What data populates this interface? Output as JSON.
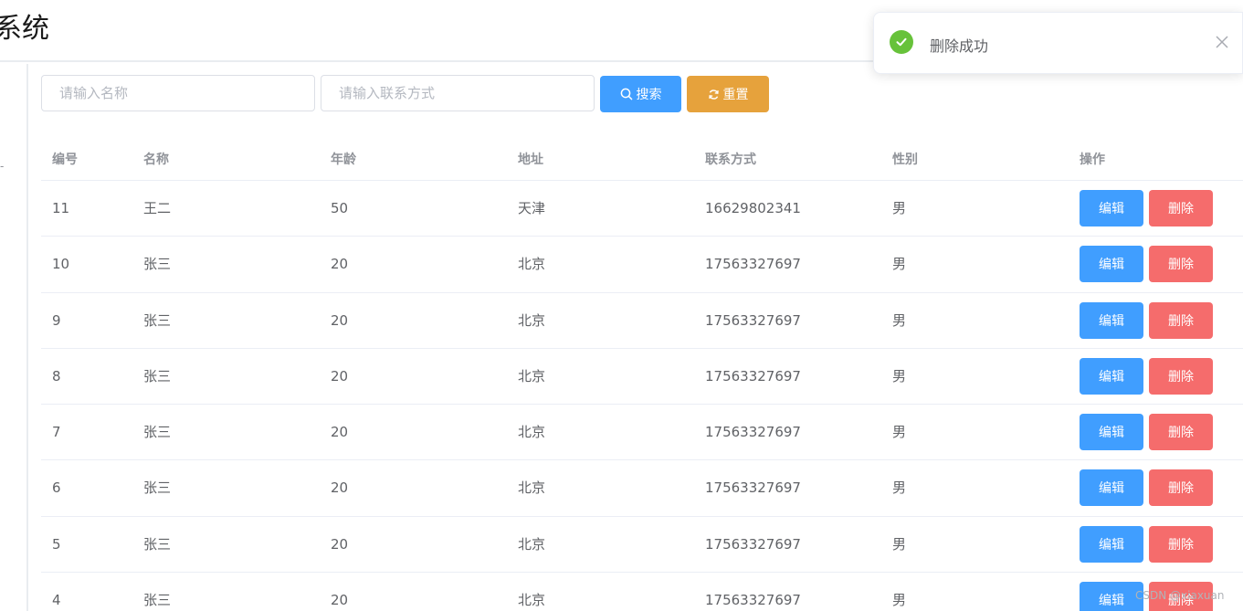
{
  "header": {
    "title": "系统"
  },
  "sidebar": {
    "mark": "-"
  },
  "search": {
    "name_placeholder": "请输入名称",
    "contact_placeholder": "请输入联系方式",
    "search_label": "搜索",
    "reset_label": "重置"
  },
  "table": {
    "columns": [
      "编号",
      "名称",
      "年龄",
      "地址",
      "联系方式",
      "性别",
      "操作"
    ],
    "rows": [
      {
        "id": "11",
        "name": "王二",
        "age": "50",
        "address": "天津",
        "phone": "16629802341",
        "gender": "男"
      },
      {
        "id": "10",
        "name": "张三",
        "age": "20",
        "address": "北京",
        "phone": "17563327697",
        "gender": "男"
      },
      {
        "id": "9",
        "name": "张三",
        "age": "20",
        "address": "北京",
        "phone": "17563327697",
        "gender": "男"
      },
      {
        "id": "8",
        "name": "张三",
        "age": "20",
        "address": "北京",
        "phone": "17563327697",
        "gender": "男"
      },
      {
        "id": "7",
        "name": "张三",
        "age": "20",
        "address": "北京",
        "phone": "17563327697",
        "gender": "男"
      },
      {
        "id": "6",
        "name": "张三",
        "age": "20",
        "address": "北京",
        "phone": "17563327697",
        "gender": "男"
      },
      {
        "id": "5",
        "name": "张三",
        "age": "20",
        "address": "北京",
        "phone": "17563327697",
        "gender": "男"
      },
      {
        "id": "4",
        "name": "张三",
        "age": "20",
        "address": "北京",
        "phone": "17563327697",
        "gender": "男"
      }
    ],
    "edit_label": "编辑",
    "delete_label": "删除"
  },
  "toast": {
    "message": "删除成功",
    "icon": "check-circle-icon",
    "close_icon": "close-icon"
  },
  "watermark": "CSDN @xiaxuan",
  "colors": {
    "primary": "#409eff",
    "warning": "#e6a23c",
    "danger": "#f56c6c",
    "success": "#67c23a"
  }
}
